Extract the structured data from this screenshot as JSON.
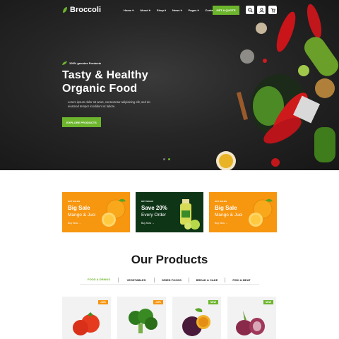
{
  "header": {
    "logo": "Broccoli",
    "nav": [
      {
        "label": "Home ▾"
      },
      {
        "label": "About ▾"
      },
      {
        "label": "Shop ▾"
      },
      {
        "label": "News ▾"
      },
      {
        "label": "Pages ▾"
      },
      {
        "label": "Contact"
      }
    ],
    "quote_button": "GET A QUOTE",
    "icons": [
      "search-icon",
      "user-icon",
      "cart-icon"
    ],
    "cart_count": "0"
  },
  "hero": {
    "tagline": "100% genuine Products",
    "title_line1": "Tasty & Healthy",
    "title_line2": "Organic Food",
    "description": "Lorem ipsum dolor sit amet, consectetur adipisicing elit, sed do eiusmod tempor incididunt ut labore.",
    "button": "EXPLORE PRODUCTS",
    "slider": {
      "count": 2,
      "active": 0
    }
  },
  "banners": [
    {
      "tag": "HOT SALES",
      "title": "Big Sale",
      "subtitle": "Mango & Juci",
      "link": "Buy Now →",
      "color": "#f7960f"
    },
    {
      "tag": "HOT SALES",
      "title": "Save 20%",
      "subtitle": "Every Order",
      "link": "Buy Now →",
      "color": "#0f3517"
    },
    {
      "tag": "HOT SALES",
      "title": "Big Sale",
      "subtitle": "Mango & Juci",
      "link": "Buy Now →",
      "color": "#f7960f"
    }
  ],
  "products": {
    "title": "Our Products",
    "tabs": [
      "FOOD & DRINKS",
      "VEGETABLES",
      "DRIED FOODS",
      "BREAD & CAKE",
      "FISH & MEAT"
    ],
    "active_tab": 0,
    "cards": [
      {
        "badge": "-10%",
        "badge_color": "#f7960f",
        "image": "tomatoes"
      },
      {
        "badge": "-10%",
        "badge_color": "#f7960f",
        "image": "broccoli"
      },
      {
        "badge": "NEW",
        "badge_color": "#6cb52d",
        "image": "passion-fruit"
      },
      {
        "badge": "NEW",
        "badge_color": "#6cb52d",
        "image": "red-onion"
      }
    ]
  },
  "colors": {
    "accent": "#6cb52d",
    "orange": "#f7960f",
    "dark_green": "#0f3517"
  }
}
